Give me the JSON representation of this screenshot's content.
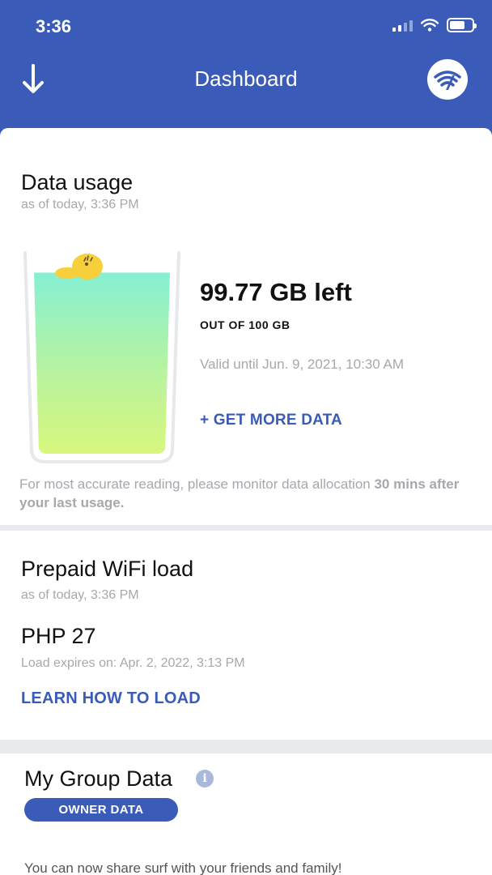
{
  "status_bar": {
    "time": "3:36"
  },
  "header": {
    "title": "Dashboard",
    "back_icon": "down-arrow-icon",
    "logo_icon": "wifi-logo-icon"
  },
  "data_usage": {
    "title": "Data usage",
    "as_of": "as of today, 3:36 PM",
    "remaining": "99.77 GB left",
    "total": "OUT OF 100 GB",
    "validity": "Valid until Jun. 9, 2021, 10:30 AM",
    "get_more": "+ GET MORE DATA",
    "fill_fraction": 0.9977,
    "note_prefix": "For most accurate reading, please monitor data allocation ",
    "note_bold": "30 mins after your last usage."
  },
  "prepaid_load": {
    "title": "Prepaid WiFi load",
    "as_of": "as of today, 3:36 PM",
    "balance": "PHP 27",
    "expires": "Load expires on: Apr. 2, 2022, 3:13 PM",
    "learn_link": "LEARN HOW TO LOAD"
  },
  "group_data": {
    "title": "My Group Data",
    "info_icon": "info-icon",
    "owner_tab": "OWNER DATA",
    "share_text": "You can now share surf with your friends and family!"
  },
  "colors": {
    "brand": "#3a5bb7",
    "muted": "#a6a8ad"
  }
}
